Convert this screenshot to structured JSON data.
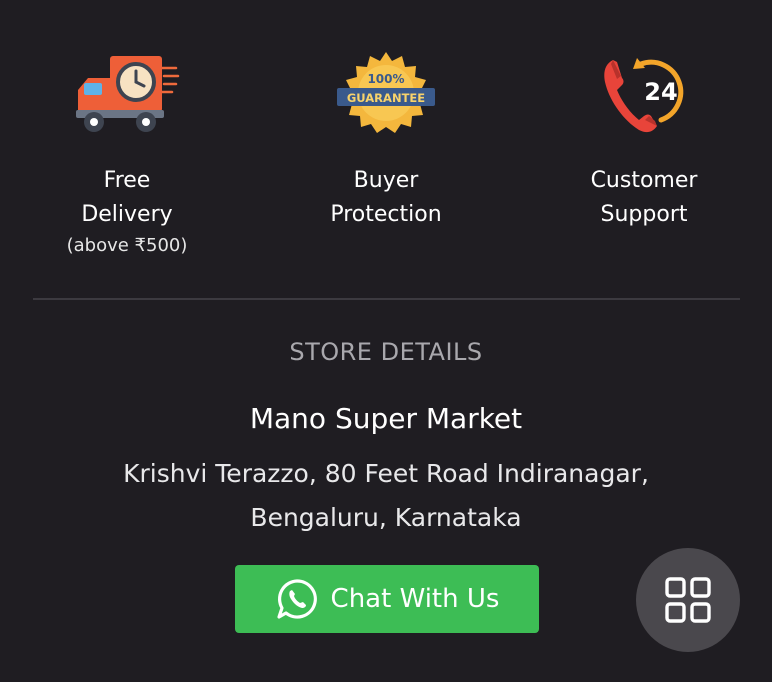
{
  "features": [
    {
      "icon": "delivery-truck-icon",
      "title": "Free\nDelivery",
      "note": "(above ₹500)"
    },
    {
      "icon": "guarantee-badge-icon",
      "title": "Buyer\nProtection",
      "badge_top": "100%",
      "badge_ribbon": "GUARANTEE"
    },
    {
      "icon": "support-phone-icon",
      "title": "Customer\nSupport",
      "badge_number": "24"
    }
  ],
  "store": {
    "heading": "STORE DETAILS",
    "name": "Mano Super Market",
    "address_line1": "Krishvi Terazzo, 80 Feet Road Indiranagar,",
    "address_line2": "Bengaluru, Karnataka"
  },
  "chat_button": {
    "label": "Chat With Us",
    "icon": "whatsapp-icon"
  },
  "fab": {
    "icon": "grid-icon"
  },
  "colors": {
    "background": "#1f1d22",
    "chat_green": "#3dbd55",
    "fab_gray": "#4a484d",
    "muted_text": "#a9a8ad"
  }
}
